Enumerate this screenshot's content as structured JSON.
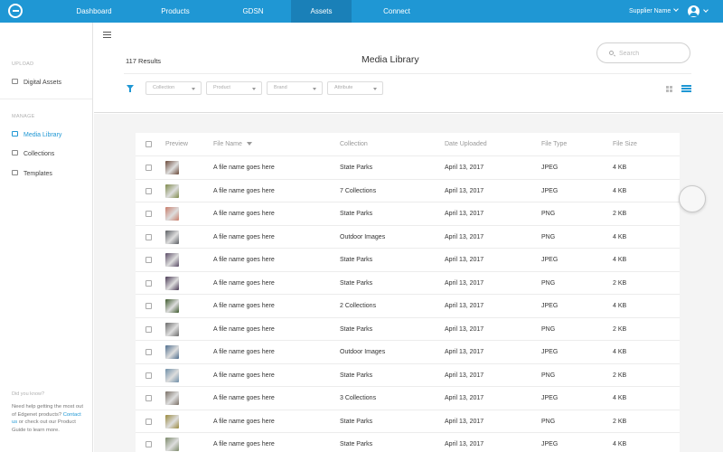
{
  "nav": {
    "tabs": [
      {
        "label": "Dashboard"
      },
      {
        "label": "Products"
      },
      {
        "label": "GDSN"
      },
      {
        "label": "Assets",
        "active": true
      },
      {
        "label": "Connect"
      }
    ],
    "supplier_name": "Supplier Name",
    "logo_icon": "edgenet-logo-icon",
    "user_icon": "user-avatar-icon"
  },
  "sidebar": {
    "upload_section": "UPLOAD",
    "manage_section": "MANAGE",
    "items": [
      {
        "label": "Digital Assets",
        "icon": "camera-icon"
      },
      {
        "label": "Media Library",
        "icon": "media-icon",
        "active": true
      },
      {
        "label": "Collections",
        "icon": "collections-icon"
      },
      {
        "label": "Templates",
        "icon": "templates-icon"
      }
    ],
    "did_you_know": "Did you know?",
    "help_1": "Need help getting the most out of Edgenet products?",
    "help_link": "Contact us",
    "help_2": "or check out our Product Guide to learn more."
  },
  "header": {
    "results": "117 Results",
    "title": "Media Library",
    "search_placeholder": "Search",
    "filters": [
      "Collection",
      "Product",
      "Brand",
      "Attribute"
    ]
  },
  "table": {
    "columns": {
      "preview": "Preview",
      "file_name": "File Name",
      "collection": "Collection",
      "date": "Date Uploaded",
      "type": "File Type",
      "size": "File Size"
    },
    "rows": [
      {
        "file_name": "A file name goes here",
        "collection": "State Parks",
        "date": "April 13, 2017",
        "type": "JPEG",
        "size": "4 KB",
        "thumb_color": "#6b4a3a"
      },
      {
        "file_name": "A file name goes here",
        "collection": "7 Collections",
        "date": "April 13, 2017",
        "type": "JPEG",
        "size": "4 KB",
        "thumb_color": "#7f8b4c"
      },
      {
        "file_name": "A file name goes here",
        "collection": "State Parks",
        "date": "April 13, 2017",
        "type": "PNG",
        "size": "2 KB",
        "thumb_color": "#c97d6a"
      },
      {
        "file_name": "A file name goes here",
        "collection": "Outdoor Images",
        "date": "April 13, 2017",
        "type": "PNG",
        "size": "4 KB",
        "thumb_color": "#5c5f64"
      },
      {
        "file_name": "A file name goes here",
        "collection": "State Parks",
        "date": "April 13, 2017",
        "type": "JPEG",
        "size": "4 KB",
        "thumb_color": "#5a4c66"
      },
      {
        "file_name": "A file name goes here",
        "collection": "State Parks",
        "date": "April 13, 2017",
        "type": "PNG",
        "size": "2 KB",
        "thumb_color": "#4a3a55"
      },
      {
        "file_name": "A file name goes here",
        "collection": "2 Collections",
        "date": "April 13, 2017",
        "type": "JPEG",
        "size": "4 KB",
        "thumb_color": "#3f5a2e"
      },
      {
        "file_name": "A file name goes here",
        "collection": "State Parks",
        "date": "April 13, 2017",
        "type": "PNG",
        "size": "2 KB",
        "thumb_color": "#6a6a6a"
      },
      {
        "file_name": "A file name goes here",
        "collection": "Outdoor Images",
        "date": "April 13, 2017",
        "type": "JPEG",
        "size": "4 KB",
        "thumb_color": "#4f6e8e"
      },
      {
        "file_name": "A file name goes here",
        "collection": "State Parks",
        "date": "April 13, 2017",
        "type": "PNG",
        "size": "2 KB",
        "thumb_color": "#6f8fa8"
      },
      {
        "file_name": "A file name goes here",
        "collection": "3 Collections",
        "date": "April 13, 2017",
        "type": "JPEG",
        "size": "4 KB",
        "thumb_color": "#7a7066"
      },
      {
        "file_name": "A file name goes here",
        "collection": "State Parks",
        "date": "April 13, 2017",
        "type": "PNG",
        "size": "2 KB",
        "thumb_color": "#9a8a3e"
      },
      {
        "file_name": "A file name goes here",
        "collection": "State Parks",
        "date": "April 13, 2017",
        "type": "JPEG",
        "size": "4 KB",
        "thumb_color": "#7c8a6a"
      }
    ]
  },
  "colors": {
    "brand": "#1f97d4",
    "nav_active": "#1a80b8"
  }
}
